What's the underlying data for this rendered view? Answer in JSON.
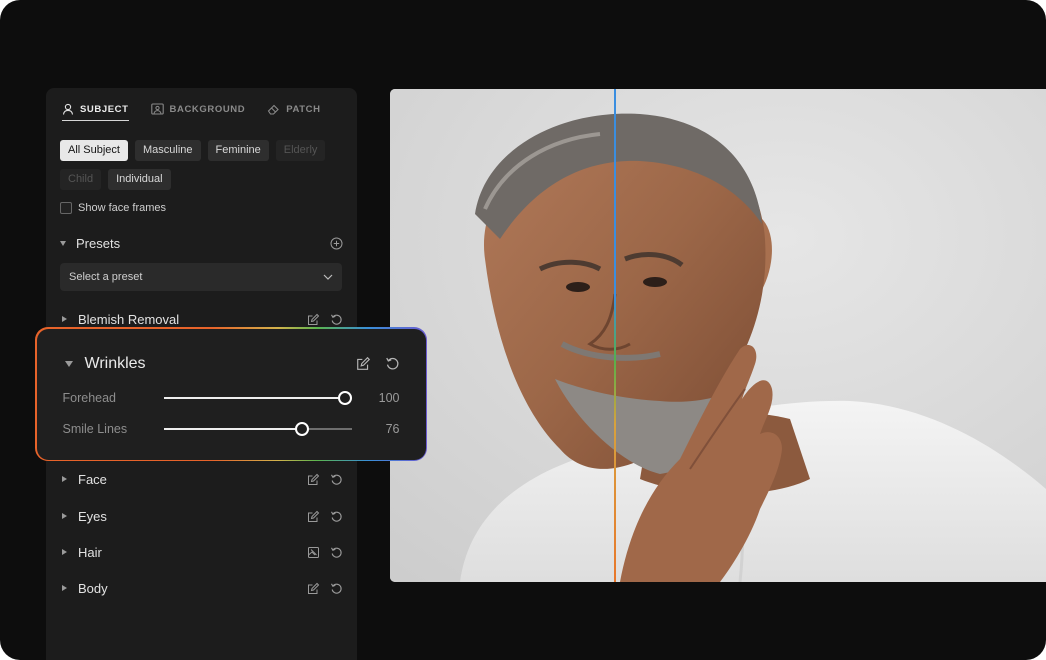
{
  "tabs": [
    {
      "label": "SUBJECT",
      "icon": "person-icon",
      "active": true
    },
    {
      "label": "BACKGROUND",
      "icon": "image-frame-icon",
      "active": false
    },
    {
      "label": "PATCH",
      "icon": "eraser-icon",
      "active": false
    }
  ],
  "filters": {
    "chips": [
      {
        "label": "All Subject",
        "state": "selected"
      },
      {
        "label": "Masculine",
        "state": "normal"
      },
      {
        "label": "Feminine",
        "state": "normal"
      },
      {
        "label": "Elderly",
        "state": "disabled"
      },
      {
        "label": "Child",
        "state": "disabled"
      },
      {
        "label": "Individual",
        "state": "normal"
      }
    ]
  },
  "show_face_frames": {
    "label": "Show face frames",
    "checked": false
  },
  "presets": {
    "label": "Presets",
    "select_placeholder": "Select a preset"
  },
  "sections": {
    "blemish": "Blemish Removal",
    "face": "Face",
    "eyes": "Eyes",
    "hair": "Hair",
    "body": "Body"
  },
  "wrinkles": {
    "title": "Wrinkles",
    "sliders": [
      {
        "label": "Forehead",
        "value": 100,
        "max": 100
      },
      {
        "label": "Smile Lines",
        "value": 76,
        "max": 100
      }
    ]
  },
  "colors": {
    "accent_orange": "#e7632a",
    "accent_blue": "#3a8ee0",
    "accent_green": "#57b04a"
  }
}
